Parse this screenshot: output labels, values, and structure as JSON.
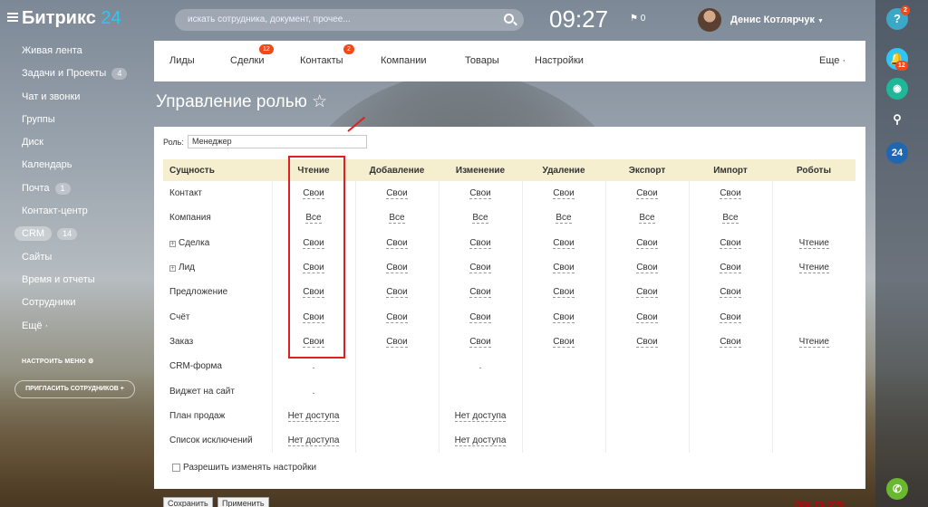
{
  "app": {
    "logo_main": "Битрикс",
    "logo_num": "24"
  },
  "topbar": {
    "search_placeholder": "искать сотрудника, документ, прочее...",
    "time": "09:27",
    "flag_count": "0",
    "user_name": "Денис Котлярчук"
  },
  "left_menu": {
    "items": [
      {
        "label": "Живая лента",
        "count": ""
      },
      {
        "label": "Задачи и Проекты",
        "count": "4"
      },
      {
        "label": "Чат и звонки",
        "count": ""
      },
      {
        "label": "Группы",
        "count": ""
      },
      {
        "label": "Диск",
        "count": ""
      },
      {
        "label": "Календарь",
        "count": ""
      },
      {
        "label": "Почта",
        "count": "1"
      },
      {
        "label": "Контакт-центр",
        "count": ""
      },
      {
        "label": "CRM",
        "count": "14"
      },
      {
        "label": "Сайты",
        "count": ""
      },
      {
        "label": "Время и отчеты",
        "count": ""
      },
      {
        "label": "Сотрудники",
        "count": ""
      },
      {
        "label": "Ещё ·",
        "count": ""
      }
    ],
    "configure": "НАСТРОИТЬ МЕНЮ",
    "invite": "ПРИГЛАСИТЬ СОТРУДНИКОВ +"
  },
  "right_bar": {
    "help_badge": "2",
    "notify_badge": "12",
    "b24": "24"
  },
  "tabs": {
    "items": [
      {
        "label": "Лиды",
        "badge": ""
      },
      {
        "label": "Сделки",
        "badge": "12"
      },
      {
        "label": "Контакты",
        "badge": "2"
      },
      {
        "label": "Компании",
        "badge": ""
      },
      {
        "label": "Товары",
        "badge": ""
      },
      {
        "label": "Настройки",
        "badge": ""
      }
    ],
    "more": "Еще ·"
  },
  "page": {
    "title": "Управление ролью ☆",
    "role_label": "Роль:",
    "role_value": "Менеджер"
  },
  "table": {
    "headers": [
      "Сущность",
      "Чтение",
      "Добавление",
      "Изменение",
      "Удаление",
      "Экспорт",
      "Импорт",
      "Роботы"
    ],
    "rows": [
      {
        "entity": "Контакт",
        "expand": false,
        "cells": [
          "Свои",
          "Свои",
          "Свои",
          "Свои",
          "Свои",
          "Свои",
          ""
        ]
      },
      {
        "entity": "Компания",
        "expand": false,
        "cells": [
          "Все",
          "Все",
          "Все",
          "Все",
          "Все",
          "Все",
          ""
        ]
      },
      {
        "entity": "Сделка",
        "expand": true,
        "cells": [
          "Свои",
          "Свои",
          "Свои",
          "Свои",
          "Свои",
          "Свои",
          "Чтение"
        ]
      },
      {
        "entity": "Лид",
        "expand": true,
        "cells": [
          "Свои",
          "Свои",
          "Свои",
          "Свои",
          "Свои",
          "Свои",
          "Чтение"
        ]
      },
      {
        "entity": "Предложение",
        "expand": false,
        "cells": [
          "Свои",
          "Свои",
          "Свои",
          "Свои",
          "Свои",
          "Свои",
          ""
        ]
      },
      {
        "entity": "Счёт",
        "expand": false,
        "cells": [
          "Свои",
          "Свои",
          "Свои",
          "Свои",
          "Свои",
          "Свои",
          ""
        ]
      },
      {
        "entity": "Заказ",
        "expand": false,
        "cells": [
          "Свои",
          "Свои",
          "Свои",
          "Свои",
          "Свои",
          "Свои",
          "Чтение"
        ]
      },
      {
        "entity": "CRM-форма",
        "expand": false,
        "cells": [
          ".",
          "",
          ".",
          "",
          "",
          "",
          ""
        ]
      },
      {
        "entity": "Виджет на сайт",
        "expand": false,
        "cells": [
          ".",
          "",
          "",
          "",
          "",
          "",
          ""
        ]
      },
      {
        "entity": "План продаж",
        "expand": false,
        "cells": [
          "Нет доступа",
          "",
          "Нет доступа",
          "",
          "",
          "",
          ""
        ]
      },
      {
        "entity": "Список исключений",
        "expand": false,
        "cells": [
          "Нет доступа",
          "",
          "Нет доступа",
          "",
          "",
          "",
          ""
        ]
      }
    ]
  },
  "footer": {
    "allow_settings": "Разрешить изменять настройки",
    "save": "Сохранить",
    "apply": "Применить",
    "delete": "Удалить роль"
  }
}
